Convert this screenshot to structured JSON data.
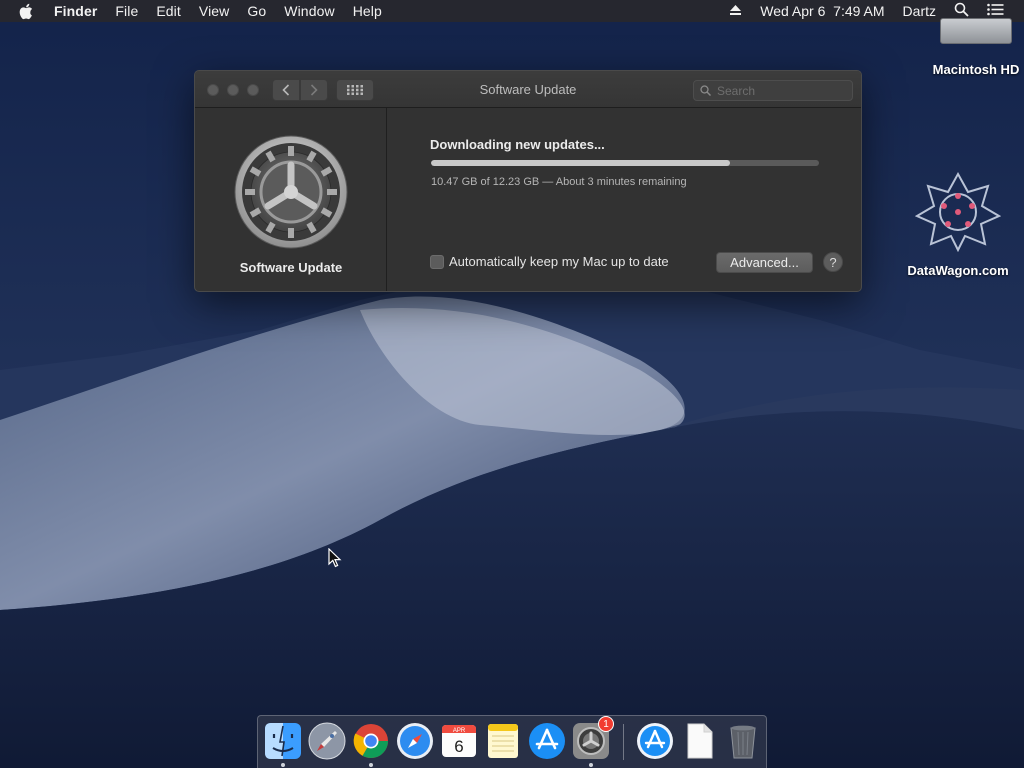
{
  "menubar": {
    "app_name": "Finder",
    "items": [
      "File",
      "Edit",
      "View",
      "Go",
      "Window",
      "Help"
    ],
    "datetime": "Wed Apr 6  7:49 AM",
    "user": "Dartz"
  },
  "desktop": {
    "icons": [
      {
        "label": "Macintosh HD"
      },
      {
        "label": "DataWagon.com"
      }
    ]
  },
  "window": {
    "title": "Software Update",
    "search_placeholder": "Search",
    "pane_label": "Software Update",
    "status_title": "Downloading new updates...",
    "progress": {
      "fraction": 0.77,
      "text": "10.47 GB of 12.23 GB — About 3 minutes remaining"
    },
    "auto_update_label": "Automatically keep my Mac up to date",
    "auto_update_checked": false,
    "advanced_button": "Advanced...",
    "help_button": "?"
  },
  "dock": {
    "items": [
      {
        "name": "finder-icon",
        "running": true
      },
      {
        "name": "launchpad-icon",
        "running": false
      },
      {
        "name": "chrome-icon",
        "running": true
      },
      {
        "name": "safari-icon",
        "running": false
      },
      {
        "name": "calendar-icon",
        "running": false,
        "text_month": "APR",
        "text_day": "6"
      },
      {
        "name": "notes-icon",
        "running": false
      },
      {
        "name": "app-store-icon",
        "running": false
      },
      {
        "name": "system-preferences-icon",
        "running": true,
        "badge": "1"
      },
      {
        "name": "app-store-downloads-icon",
        "running": false
      },
      {
        "name": "document-icon",
        "running": false
      },
      {
        "name": "trash-icon",
        "running": false
      }
    ]
  },
  "colors": {
    "window_bg": "#323232",
    "progress_fill": "#c8c8c8",
    "badge": "#f23c31"
  }
}
